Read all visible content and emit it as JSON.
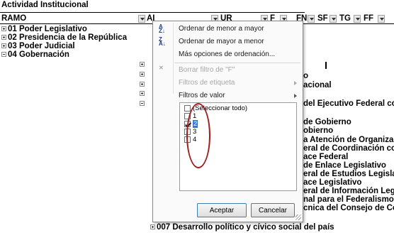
{
  "sheet": {
    "title": "Actividad Institucional",
    "ramo_label": "RAMO",
    "columns": [
      "AI",
      "UR",
      "F",
      "FN",
      "SF",
      "TG",
      "FF"
    ],
    "ramo_rows": [
      {
        "expander": "plus",
        "label": "01 Poder Legislativo"
      },
      {
        "expander": "plus",
        "label": "02 Presidencia de la República"
      },
      {
        "expander": "plus",
        "label": "03 Poder Judicial"
      },
      {
        "expander": "minus",
        "label": "04 Gobernación"
      }
    ],
    "right_rows": [
      "o",
      "acional",
      " del Ejecutivo Federal co",
      " de Gobierno",
      "obierno",
      "a Atención de Organizac",
      "eral de Coordinación co",
      "ace Federal",
      " de Enlace Legislativo",
      "eral de Estudios Legisla",
      "ace Legislativo",
      "eral de Información Leg",
      "nal para el Federalismo",
      "cnica del Consejo de Co"
    ],
    "bottom_row": "007 Desarrollo político y cívico social del país"
  },
  "filter_menu": {
    "items": [
      {
        "label": "Ordenar de menor a mayor",
        "icon": "sort-asc-icon",
        "disabled": false,
        "submenu": false
      },
      {
        "label": "Ordenar de mayor a menor",
        "icon": "sort-desc-icon",
        "disabled": false,
        "submenu": false
      },
      {
        "label": "Más opciones de ordenación...",
        "icon": "",
        "disabled": false,
        "submenu": false
      },
      {
        "label": "Borrar filtro de \"F\"",
        "icon": "clear-filter-icon",
        "disabled": true,
        "submenu": false
      },
      {
        "label": "Filtros de etiqueta",
        "icon": "",
        "disabled": true,
        "submenu": true
      },
      {
        "label": "Filtros de valor",
        "icon": "",
        "disabled": false,
        "submenu": true
      }
    ],
    "list": [
      {
        "label": "(Seleccionar todo)",
        "checked": false,
        "selected": false
      },
      {
        "label": "1",
        "checked": false,
        "selected": false
      },
      {
        "label": "2",
        "checked": true,
        "selected": true
      },
      {
        "label": "3",
        "checked": false,
        "selected": false
      },
      {
        "label": "4",
        "checked": false,
        "selected": false
      }
    ],
    "ok_label": "Aceptar",
    "cancel_label": "Cancelar"
  },
  "colors": {
    "menu_bg": "#fafafa",
    "selection": "#3875d6",
    "annotation": "#a02020",
    "icon_blue": "#1c3c8c"
  }
}
